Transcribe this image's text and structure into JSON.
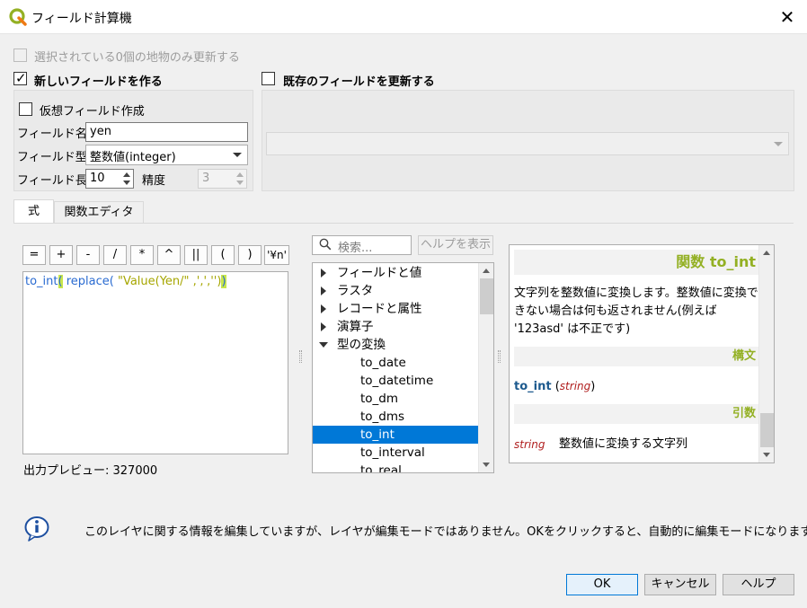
{
  "window": {
    "title": "フィールド計算機",
    "close": "✕"
  },
  "options": {
    "selected_only": "選択されている0個の地物のみ更新する",
    "create_new": "新しいフィールドを作る",
    "update_existing": "既存のフィールドを更新する",
    "virtual_field": "仮想フィールド作成"
  },
  "new_field": {
    "name_label": "フィールド名",
    "name_value": "yen",
    "type_label": "フィールド型",
    "type_value": "整数値(integer)",
    "length_label": "フィールド長",
    "length_value": "10",
    "precision_label": "精度",
    "precision_value": "3"
  },
  "tabs": [
    {
      "label": "式"
    },
    {
      "label": "関数エディタ"
    }
  ],
  "operators": [
    "=",
    "+",
    "-",
    "/",
    "*",
    "^",
    "||",
    "(",
    ")",
    "'¥n'"
  ],
  "expression": {
    "fn1": "to_int",
    "paren_open": "(",
    "fn2": " replace(",
    "str1": " \"Value(Yen/\"",
    "rest": " ,',','')",
    "paren_close": ")"
  },
  "preview": "出力プレビュー: 327000",
  "search": {
    "placeholder": "検索...",
    "help_button": "ヘルプを表示"
  },
  "tree": {
    "groups": [
      "フィールドと値",
      "ラスタ",
      "レコードと属性",
      "演算子",
      "型の変換"
    ],
    "items": [
      "to_date",
      "to_datetime",
      "to_dm",
      "to_dms",
      "to_int",
      "to_interval",
      "to_real"
    ],
    "selected": "to_int"
  },
  "help": {
    "title": "関数 to_int",
    "description": "文字列を整数値に変換します。整数値に変換できない場合は何も返されません(例えば '123asd' は不正です)",
    "syntax_heading": "構文",
    "syntax_fn": "to_int",
    "syntax_open": " (",
    "syntax_arg": "string",
    "syntax_close": ")",
    "args_heading": "引数",
    "arg_name": "string",
    "arg_desc": "整数値に変換する文字列"
  },
  "info_message": "このレイヤに関する情報を編集していますが、レイヤが編集モードではありません。OKをクリックすると、自動的に編集モードになります。",
  "buttons": {
    "ok": "OK",
    "cancel": "キャンセル",
    "help": "ヘルプ"
  },
  "colors": {
    "accent": "#0078d7",
    "help_heading": "#93b023",
    "function_name": "#1d5a8e",
    "arg_name": "#b01e1e"
  }
}
